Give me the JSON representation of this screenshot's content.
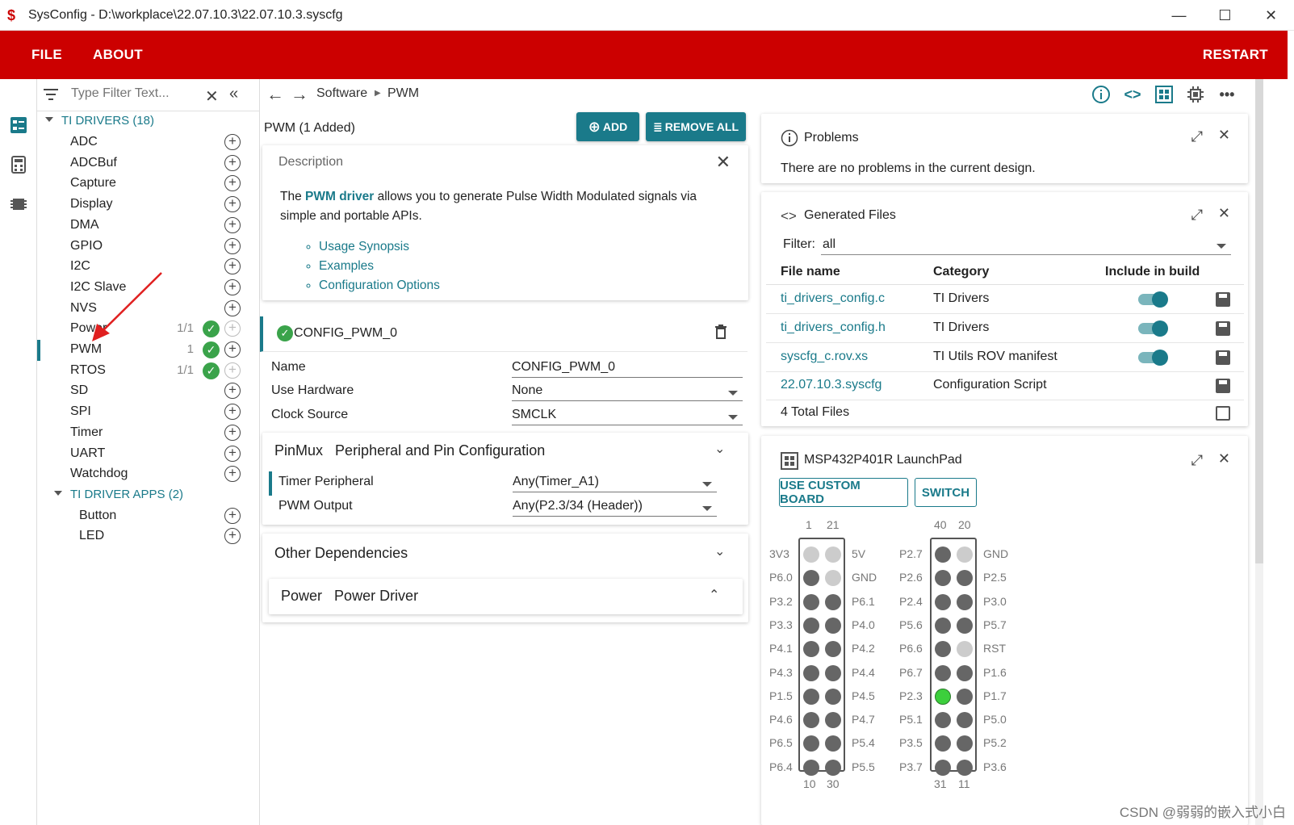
{
  "window": {
    "title": "SysConfig - D:\\workplace\\22.07.10.3\\22.07.10.3.syscfg"
  },
  "menu": {
    "file": "FILE",
    "about": "ABOUT",
    "restart": "RESTART"
  },
  "tree": {
    "filter_placeholder": "Type Filter Text...",
    "group1": "TI DRIVERS (18)",
    "items": [
      {
        "label": "ADC",
        "count": "",
        "ok": false
      },
      {
        "label": "ADCBuf",
        "count": "",
        "ok": false
      },
      {
        "label": "Capture",
        "count": "",
        "ok": false
      },
      {
        "label": "Display",
        "count": "",
        "ok": false
      },
      {
        "label": "DMA",
        "count": "",
        "ok": false
      },
      {
        "label": "GPIO",
        "count": "",
        "ok": false
      },
      {
        "label": "I2C",
        "count": "",
        "ok": false
      },
      {
        "label": "I2C Slave",
        "count": "",
        "ok": false
      },
      {
        "label": "NVS",
        "count": "",
        "ok": false
      },
      {
        "label": "Power",
        "count": "1/1",
        "ok": true
      },
      {
        "label": "PWM",
        "count": "1",
        "ok": true
      },
      {
        "label": "RTOS",
        "count": "1/1",
        "ok": true
      },
      {
        "label": "SD",
        "count": "",
        "ok": false
      },
      {
        "label": "SPI",
        "count": "",
        "ok": false
      },
      {
        "label": "Timer",
        "count": "",
        "ok": false
      },
      {
        "label": "UART",
        "count": "",
        "ok": false
      },
      {
        "label": "Watchdog",
        "count": "",
        "ok": false
      }
    ],
    "group2": "TI DRIVER APPS (2)",
    "apps": [
      "Button",
      "LED"
    ]
  },
  "breadcrumb": {
    "software": "Software",
    "module": "PWM"
  },
  "module": {
    "header": "PWM (1 Added)",
    "add_label": "ADD",
    "remove_all_label": "REMOVE ALL",
    "description_title": "Description",
    "desc_pre": "The ",
    "desc_link": "PWM driver",
    "desc_post": " allows you to generate Pulse Width Modulated signals via simple and portable APIs.",
    "links": [
      "Usage Synopsis",
      "Examples",
      "Configuration Options"
    ],
    "instance_name": "CONFIG_PWM_0",
    "props": [
      {
        "label": "Name",
        "value": "CONFIG_PWM_0"
      },
      {
        "label": "Use Hardware",
        "value": "None"
      },
      {
        "label": "Clock Source",
        "value": "SMCLK"
      }
    ],
    "pinmux_title": "PinMux",
    "pinmux_sub": "Peripheral and Pin Configuration",
    "pinmux_props": [
      {
        "label": "Timer Peripheral",
        "value": "Any(Timer_A1)"
      },
      {
        "label": "PWM Output",
        "value": "Any(P2.3/34 (Header))"
      }
    ],
    "other_deps": "Other Dependencies",
    "power_title": "Power",
    "power_sub": "Power Driver"
  },
  "problems": {
    "title": "Problems",
    "message": "There are no problems in the current design."
  },
  "generated": {
    "title": "Generated Files",
    "filter_label": "Filter:",
    "filter_value": "all",
    "col_name": "File name",
    "col_category": "Category",
    "col_include": "Include in build",
    "files": [
      {
        "name": "ti_drivers_config.c",
        "category": "TI Drivers",
        "toggle": true
      },
      {
        "name": "ti_drivers_config.h",
        "category": "TI Drivers",
        "toggle": true
      },
      {
        "name": "syscfg_c.rov.xs",
        "category": "TI Utils ROV manifest",
        "toggle": true
      },
      {
        "name": "22.07.10.3.syscfg",
        "category": "Configuration Script",
        "toggle": false
      }
    ],
    "total": "4 Total Files"
  },
  "board": {
    "title": "MSP432P401R LaunchPad",
    "custom_label": "USE CUSTOM BOARD",
    "switch_label": "SWITCH",
    "left_top_nums": [
      "1",
      "21"
    ],
    "left_bottom_nums": [
      "10",
      "30"
    ],
    "right_top_nums": [
      "40",
      "20"
    ],
    "right_bottom_nums": [
      "31",
      "11"
    ],
    "left_outer": [
      "3V3",
      "P6.0",
      "P3.2",
      "P3.3",
      "P4.1",
      "P4.3",
      "P1.5",
      "P4.6",
      "P6.5",
      "P6.4"
    ],
    "left_inner": [
      "5V",
      "GND",
      "P6.1",
      "P4.0",
      "P4.2",
      "P4.4",
      "P4.5",
      "P4.7",
      "P5.4",
      "P5.5"
    ],
    "right_outer": [
      "P2.7",
      "P2.6",
      "P2.4",
      "P5.6",
      "P6.6",
      "P6.7",
      "P2.3",
      "P5.1",
      "P3.5",
      "P3.7"
    ],
    "right_inner": [
      "GND",
      "P2.5",
      "P3.0",
      "P5.7",
      "RST",
      "P1.6",
      "P1.7",
      "P5.0",
      "P5.2",
      "P3.6"
    ]
  },
  "watermark": "CSDN @弱弱的嵌入式小白"
}
